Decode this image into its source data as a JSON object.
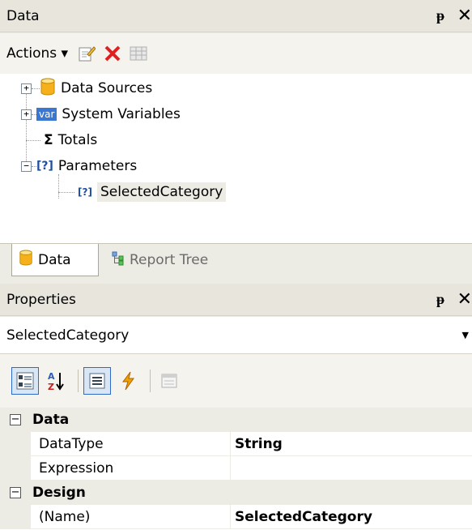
{
  "data_panel": {
    "title": "Data",
    "pin_glyph": "ᵽ",
    "close_glyph": "✕",
    "toolbar": {
      "actions_label": "Actions ▾",
      "icons": [
        "edit-icon",
        "delete-icon",
        "table-icon"
      ]
    },
    "tree": [
      {
        "label": "Data Sources",
        "icon": "database-icon",
        "expander": "+"
      },
      {
        "label": "System Variables",
        "icon": "var-icon",
        "icon_text": "var",
        "expander": "+"
      },
      {
        "label": "Totals",
        "icon": "sigma-icon",
        "icon_text": "Σ"
      },
      {
        "label": "Parameters",
        "icon": "parameters-icon",
        "icon_text": "[?]",
        "expander": "−"
      },
      {
        "label": "SelectedCategory",
        "icon": "parameter-icon",
        "icon_text": "[?]",
        "selected": true
      }
    ],
    "tabs": [
      {
        "label": "Data",
        "active": true
      },
      {
        "label": "Report Tree",
        "active": false
      }
    ]
  },
  "properties_panel": {
    "title": "Properties",
    "pin_glyph": "ᵽ",
    "close_glyph": "✕",
    "selected_object": "SelectedCategory",
    "toolbar_icons": [
      "categorized-icon",
      "alphabetical-icon",
      "properties-icon",
      "events-icon",
      "property-pages-icon"
    ],
    "categories": [
      {
        "name": "Data",
        "toggle": "−",
        "properties": [
          {
            "name": "DataType",
            "value": "String"
          },
          {
            "name": "Expression",
            "value": ""
          }
        ]
      },
      {
        "name": "Design",
        "toggle": "−",
        "properties": [
          {
            "name": "(Name)",
            "value": "SelectedCategory"
          }
        ]
      }
    ]
  },
  "colors": {
    "panel_bg": "#ecebe4",
    "selection": "#ecebe4",
    "delete_red": "#e02020",
    "database_gold": "#f5b01c",
    "var_blue": "#3a77d1"
  }
}
